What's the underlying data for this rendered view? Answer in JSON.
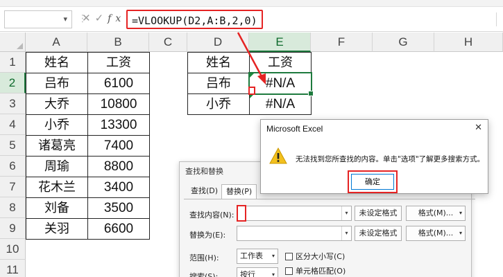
{
  "formula_bar": {
    "name_box": "",
    "formula": "=VLOOKUP(D2,A:B,2,0)",
    "cancel_icon": "✕",
    "enter_icon": "✓",
    "fx_label": "fx"
  },
  "columns": [
    "A",
    "B",
    "C",
    "D",
    "E",
    "F",
    "G",
    "H"
  ],
  "rows": [
    "1",
    "2",
    "3",
    "4",
    "5",
    "6",
    "7",
    "8",
    "9",
    "10",
    "11"
  ],
  "table_left": {
    "headers": [
      "姓名",
      "工资"
    ],
    "rows": [
      [
        "吕布",
        "6100"
      ],
      [
        "大乔",
        "10800"
      ],
      [
        "小乔",
        "13300"
      ],
      [
        "诸葛亮",
        "7400"
      ],
      [
        "周瑜",
        "8800"
      ],
      [
        "花木兰",
        "3400"
      ],
      [
        "刘备",
        "3500"
      ],
      [
        "关羽",
        "6600"
      ]
    ]
  },
  "table_right": {
    "headers": [
      "姓名",
      "工资"
    ],
    "rows": [
      [
        "吕布",
        "#N/A"
      ],
      [
        "小乔",
        "#N/A"
      ]
    ]
  },
  "find_replace": {
    "title": "查找和替换",
    "tab_find": "查找(D)",
    "tab_replace": "替换(P)",
    "find_label": "查找内容(N):",
    "find_value": "",
    "replace_label": "替换为(E):",
    "replace_value": "",
    "no_format_1": "未设定格式",
    "no_format_2": "未设定格式",
    "format_btn_1": "格式(M)...",
    "format_btn_2": "格式(M)...",
    "scope_label": "范围(H):",
    "scope_value": "工作表",
    "search_label": "搜索(S):",
    "search_value": "按行",
    "match_case": "区分大小写(C)",
    "match_cell": "单元格匹配(O)"
  },
  "message_box": {
    "title": "Microsoft Excel",
    "message": "无法找到您所查找的内容。单击\"选项\"了解更多搜索方式。",
    "ok_label": "确定"
  },
  "colors": {
    "accent_green": "#1e7a3e",
    "annotation_red": "#e52323",
    "warning_yellow": "#f2c01e"
  },
  "icons": {
    "warning": "warning-icon",
    "close": "close-icon"
  }
}
